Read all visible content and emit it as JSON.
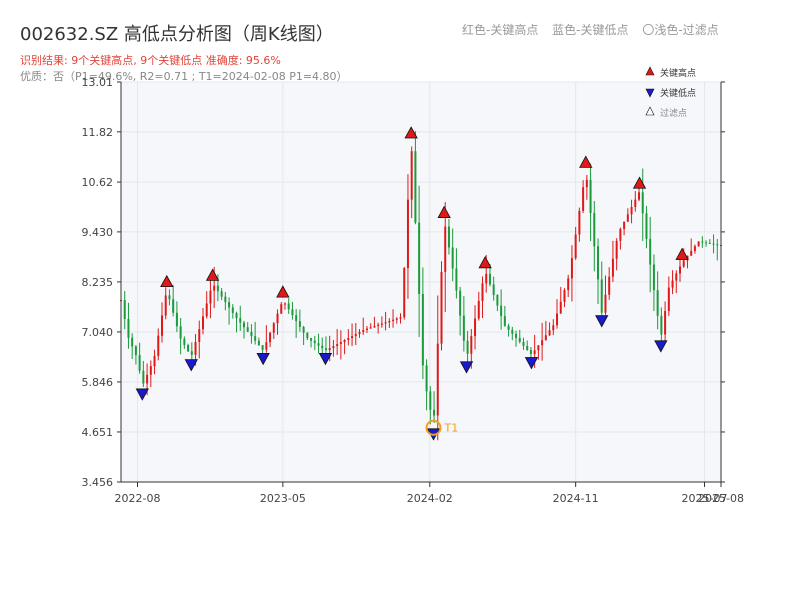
{
  "title": "002632.SZ 高低点分析图（周K线图）",
  "subtitle_result": "识别结果: 9个关键高点, 9个关键低点  准确度: 95.6%",
  "subtitle_quality": "优质：否（P1=49.6%, R2=0.71 ; T1=2024-02-08 P1=4.80）",
  "top_legend": {
    "red": "红色-关键高点",
    "blue": "蓝色-关键低点",
    "light": "〇浅色-过滤点"
  },
  "colors": {
    "up": "#e01818",
    "down": "#1a9a3a",
    "high": "#e01818",
    "low": "#1a1acc",
    "t1": "#f0a020",
    "plot_bg": "#f5f7fa"
  },
  "chart_data": {
    "type": "candlestick",
    "y_ticks": [
      3.456,
      4.651,
      5.846,
      7.04,
      8.235,
      9.43,
      10.62,
      11.82,
      13.01
    ],
    "y_tick_labels": [
      "3.456",
      "4.651",
      "5.846",
      "7.040",
      "8.235",
      "9.430",
      "10.62",
      "11.82",
      "13.01"
    ],
    "ylim": [
      3.456,
      13.01
    ],
    "x_range": [
      "2022-07-01",
      "2025-08-01"
    ],
    "x_ticks": [
      {
        "date": "2022-08-01",
        "label": "2022-08"
      },
      {
        "date": "2023-05-01",
        "label": "2023-05"
      },
      {
        "date": "2024-02-01",
        "label": "2024-02"
      },
      {
        "date": "2024-11-01",
        "label": "2024-11"
      },
      {
        "date": "2025-07-01",
        "label": "2025-07"
      },
      {
        "date": "2025-08-01",
        "label": "2025-08"
      }
    ],
    "anchors": [
      {
        "date": "2022-07-01",
        "price": 7.8
      },
      {
        "date": "2022-07-15",
        "price": 6.9
      },
      {
        "date": "2022-08-01",
        "price": 6.4
      },
      {
        "date": "2022-08-10",
        "price": 5.75
      },
      {
        "date": "2022-09-01",
        "price": 6.4
      },
      {
        "date": "2022-09-25",
        "price": 8.05
      },
      {
        "date": "2022-10-20",
        "price": 6.9
      },
      {
        "date": "2022-11-10",
        "price": 6.45
      },
      {
        "date": "2022-12-20",
        "price": 8.2
      },
      {
        "date": "2023-02-01",
        "price": 7.4
      },
      {
        "date": "2023-03-25",
        "price": 6.6
      },
      {
        "date": "2023-05-01",
        "price": 7.8
      },
      {
        "date": "2023-06-15",
        "price": 6.9
      },
      {
        "date": "2023-07-20",
        "price": 6.6
      },
      {
        "date": "2023-10-01",
        "price": 7.1
      },
      {
        "date": "2023-12-10",
        "price": 7.4
      },
      {
        "date": "2023-12-28",
        "price": 11.6
      },
      {
        "date": "2024-01-20",
        "price": 6.0
      },
      {
        "date": "2024-02-08",
        "price": 4.8
      },
      {
        "date": "2024-02-28",
        "price": 9.7
      },
      {
        "date": "2024-03-20",
        "price": 8.2
      },
      {
        "date": "2024-04-10",
        "price": 6.4
      },
      {
        "date": "2024-05-15",
        "price": 8.5
      },
      {
        "date": "2024-06-20",
        "price": 7.2
      },
      {
        "date": "2024-08-10",
        "price": 6.5
      },
      {
        "date": "2024-09-20",
        "price": 7.2
      },
      {
        "date": "2024-10-20",
        "price": 8.4
      },
      {
        "date": "2024-11-20",
        "price": 10.9
      },
      {
        "date": "2024-12-20",
        "price": 7.5
      },
      {
        "date": "2025-01-20",
        "price": 9.4
      },
      {
        "date": "2025-03-01",
        "price": 10.4
      },
      {
        "date": "2025-04-10",
        "price": 6.9
      },
      {
        "date": "2025-04-25",
        "price": 8.1
      },
      {
        "date": "2025-05-20",
        "price": 8.7
      },
      {
        "date": "2025-06-20",
        "price": 9.2
      },
      {
        "date": "2025-08-01",
        "price": 9.1
      }
    ],
    "key_highs": [
      {
        "date": "2022-09-25",
        "price": 8.05
      },
      {
        "date": "2022-12-20",
        "price": 8.2
      },
      {
        "date": "2023-05-01",
        "price": 7.8
      },
      {
        "date": "2023-12-28",
        "price": 11.6
      },
      {
        "date": "2024-02-28",
        "price": 9.7
      },
      {
        "date": "2024-05-15",
        "price": 8.5
      },
      {
        "date": "2024-11-20",
        "price": 10.9
      },
      {
        "date": "2025-03-01",
        "price": 10.4
      },
      {
        "date": "2025-05-20",
        "price": 8.7
      }
    ],
    "key_lows": [
      {
        "date": "2022-08-10",
        "price": 5.75
      },
      {
        "date": "2022-11-10",
        "price": 6.45
      },
      {
        "date": "2023-03-25",
        "price": 6.6
      },
      {
        "date": "2023-07-20",
        "price": 6.6
      },
      {
        "date": "2024-02-08",
        "price": 4.8
      },
      {
        "date": "2024-04-10",
        "price": 6.4
      },
      {
        "date": "2024-08-10",
        "price": 6.5
      },
      {
        "date": "2024-12-20",
        "price": 7.5
      },
      {
        "date": "2025-04-10",
        "price": 6.9
      }
    ],
    "t1": {
      "date": "2024-02-08",
      "price": 4.8,
      "label": "T1"
    },
    "legend": [
      {
        "kind": "high",
        "label": "关键高点"
      },
      {
        "kind": "low",
        "label": "关键低点"
      },
      {
        "kind": "filtered",
        "label": "过滤点"
      }
    ]
  }
}
